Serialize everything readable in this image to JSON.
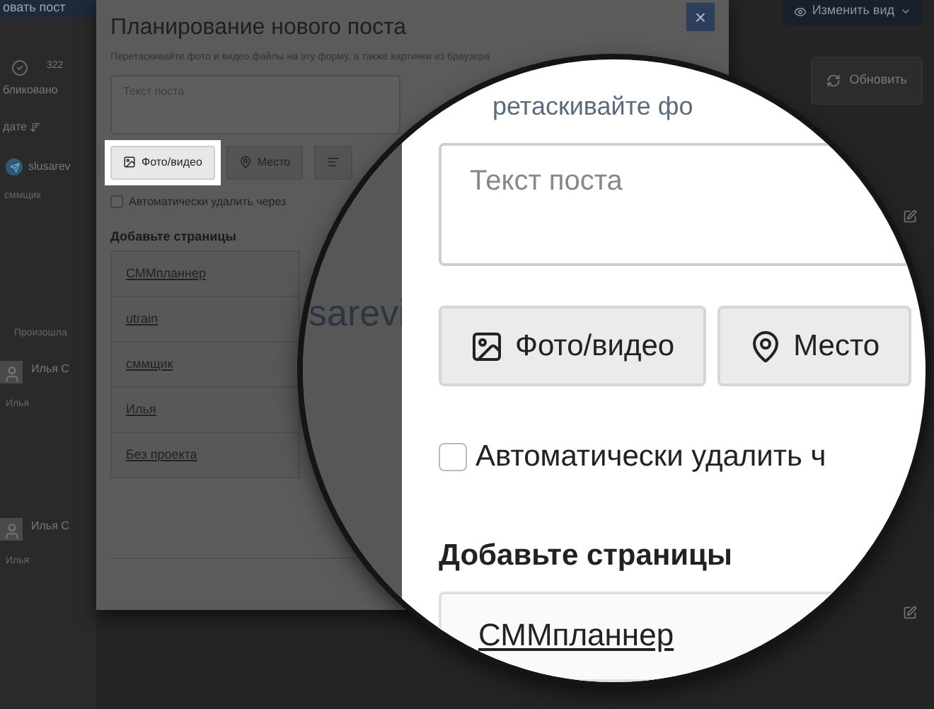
{
  "background": {
    "top_button": "овать пост",
    "published_count": "322",
    "published_label": "бликовано",
    "sort_label": "дате",
    "channel": {
      "name": "slusarev",
      "caption": "сммщик"
    },
    "notice": "Произошла",
    "posts": [
      {
        "author": "Илья С",
        "caption": "Илья"
      },
      {
        "author": "Илья С",
        "caption": "Илья"
      }
    ],
    "view_button": "Изменить вид",
    "refresh_button": "Обновить"
  },
  "modal": {
    "title": "Планирование нового поста",
    "close": "×",
    "hint": "Перетаскивайте фото и видео файлы на эту форму, а также картинки из браузера",
    "text_placeholder": "Текст поста",
    "buttons": [
      {
        "kind": "photo",
        "label": "Фото/видео",
        "spotlight": true
      },
      {
        "kind": "place",
        "label": "Место",
        "spotlight": false
      },
      {
        "kind": "text",
        "spotlight": false
      }
    ],
    "auto_delete": {
      "label": "Автоматически удалить через",
      "checked": false
    },
    "pages_heading": "Добавьте страницы",
    "pages": [
      "СММпланнер",
      "utrain",
      "сммщик",
      "Илья",
      "Без проекта"
    ]
  },
  "magnifier": {
    "background_text": "sarevi",
    "hint": "ретаскивайте фо",
    "text_placeholder": "Текст поста",
    "buttons": [
      {
        "kind": "photo",
        "label": "Фото/видео"
      },
      {
        "kind": "place",
        "label": "Место"
      }
    ],
    "auto_delete": {
      "label": "Автоматически удалить ч",
      "checked": false
    },
    "pages_heading": "Добавьте страницы",
    "pages": [
      "СММпланнер"
    ]
  }
}
